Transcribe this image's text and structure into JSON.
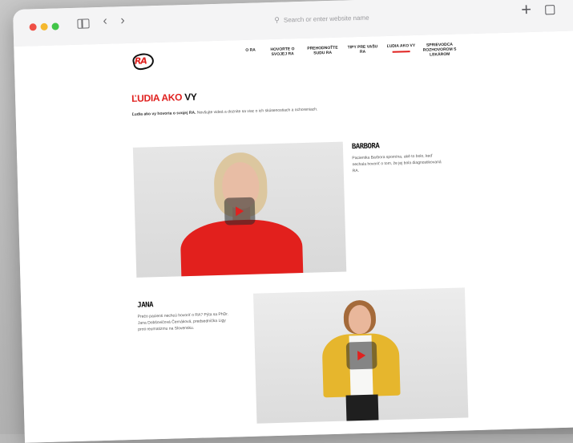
{
  "browser": {
    "address_placeholder": "Search or enter website name",
    "plus_label": "+",
    "back_label": "‹",
    "forward_label": "›"
  },
  "site": {
    "logo_text": "RA",
    "menu": [
      {
        "label": "O RA"
      },
      {
        "label": "HOVORTE O SVOJEJ RA"
      },
      {
        "label": "PREHODNOŤTE SUDU RA"
      },
      {
        "label": "TIPY PRE VAŠU RA"
      },
      {
        "label": "ĽUDIA AKO VY"
      },
      {
        "label": "SPRIEVODCA ROZHOVOROM S LEKÁROM"
      }
    ]
  },
  "main": {
    "title_part1": "ĽUDIA AKO",
    "title_part2": " VY",
    "intro_bold": "Ľudia ako vy hovoria o svojej RA.",
    "intro_rest": " Nevšujte videá a doznite sa viac o ich skúsenostiach a ochoreniach."
  },
  "people": [
    {
      "name": "BARBORA",
      "description": "Pacientka Barbora spomína, aké to bolo, keď nechala hovoriť o tom, že jej bola diagnostikovaná RA."
    },
    {
      "name": "JANA",
      "description": "Prečo pacienti nechcú hovoriť o RA? Pýta sa PhDr. Jana Dobšovičová Černáková, predsedníčka Ligy proti reumatizmu na Slovensku."
    }
  ],
  "colors": {
    "accent": "#e0211f",
    "jacket_red": "#e2201d",
    "jacket_yellow": "#e6b62d"
  }
}
